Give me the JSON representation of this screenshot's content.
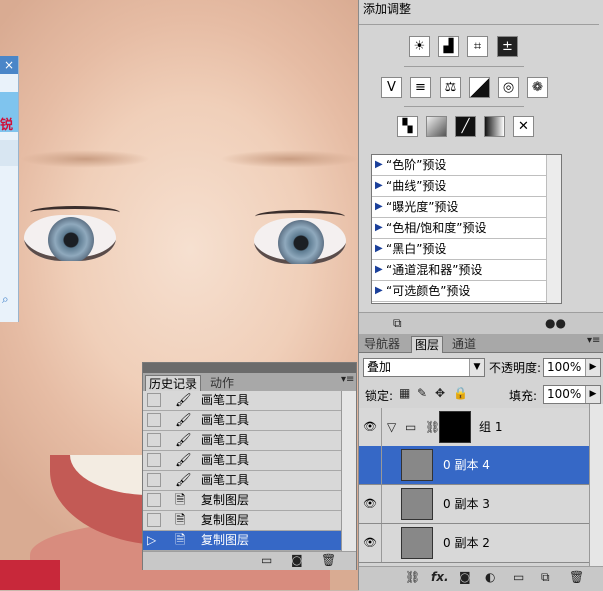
{
  "left_window": {
    "close_glyph": "×",
    "logo_text": "锐",
    "search_glyph": "⌕"
  },
  "adjustments": {
    "title": "添加调整",
    "row1_icons": [
      "brightness-contrast-icon",
      "levels-icon",
      "curves-icon",
      "exposure-icon"
    ],
    "row2_icons": [
      "vibrance-icon",
      "hue-saturation-icon",
      "color-balance-icon",
      "black-white-icon",
      "photo-filter-icon",
      "channel-mixer-icon"
    ],
    "row3_icons": [
      "invert-icon",
      "posterize-icon",
      "threshold-icon",
      "gradient-map-icon",
      "selective-color-icon"
    ],
    "presets": [
      "“色阶”预设",
      "“曲线”预设",
      "“曝光度”预设",
      "“色相/饱和度”预设",
      "“黑白”预设",
      "“通道混和器”预设",
      "“可选颜色”预设"
    ]
  },
  "layers_panel": {
    "tabs": [
      "导航器",
      "图层",
      "通道"
    ],
    "active_tab": "图层",
    "blend_mode": "叠加",
    "opacity_label": "不透明度:",
    "opacity_value": "100%",
    "lock_label": "锁定:",
    "fill_label": "填充:",
    "fill_value": "100%",
    "layers": [
      {
        "name": "组 1",
        "type": "group"
      },
      {
        "name": "0 副本 4",
        "selected": true
      },
      {
        "name": "0 副本 3"
      },
      {
        "name": "0 副本 2"
      }
    ],
    "bottom_fx": "fx."
  },
  "history_panel": {
    "tabs": [
      "历史记录",
      "动作"
    ],
    "active_tab": "历史记录",
    "items": [
      {
        "label": "画笔工具",
        "icon": "brush-icon"
      },
      {
        "label": "画笔工具",
        "icon": "brush-icon"
      },
      {
        "label": "画笔工具",
        "icon": "brush-icon"
      },
      {
        "label": "画笔工具",
        "icon": "brush-icon"
      },
      {
        "label": "画笔工具",
        "icon": "brush-icon"
      },
      {
        "label": "复制图层",
        "icon": "duplicate-layer-icon"
      },
      {
        "label": "复制图层",
        "icon": "duplicate-layer-icon"
      },
      {
        "label": "复制图层",
        "icon": "duplicate-layer-icon",
        "selected": true
      }
    ]
  },
  "colors": {
    "selection": "#3668c6",
    "panel": "#d4d4d4"
  }
}
